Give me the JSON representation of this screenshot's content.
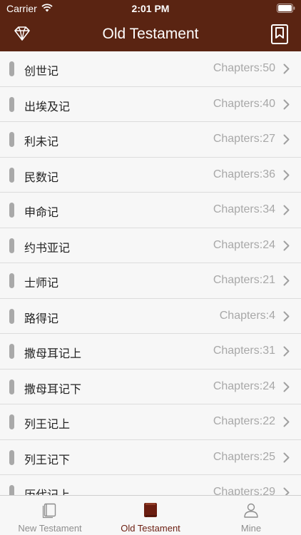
{
  "status_bar": {
    "carrier": "Carrier",
    "time": "2:01 PM"
  },
  "nav": {
    "title": "Old Testament",
    "left_icon": "diamond-icon",
    "right_icon": "bookmark-icon"
  },
  "colors": {
    "header_bg": "#5a2412",
    "active_tab": "#6b1d10",
    "marker": "#a9a9a9"
  },
  "books": [
    {
      "name": "创世记",
      "chapters": "Chapters:50"
    },
    {
      "name": "出埃及记",
      "chapters": "Chapters:40"
    },
    {
      "name": "利未记",
      "chapters": "Chapters:27"
    },
    {
      "name": "民数记",
      "chapters": "Chapters:36"
    },
    {
      "name": "申命记",
      "chapters": "Chapters:34"
    },
    {
      "name": "约书亚记",
      "chapters": "Chapters:24"
    },
    {
      "name": "士师记",
      "chapters": "Chapters:21"
    },
    {
      "name": "路得记",
      "chapters": "Chapters:4"
    },
    {
      "name": "撒母耳记上",
      "chapters": "Chapters:31"
    },
    {
      "name": "撒母耳记下",
      "chapters": "Chapters:24"
    },
    {
      "name": "列王记上",
      "chapters": "Chapters:22"
    },
    {
      "name": "列王记下",
      "chapters": "Chapters:25"
    },
    {
      "name": "历代记上",
      "chapters": "Chapters:29"
    }
  ],
  "tabs": [
    {
      "label": "New Testament",
      "icon": "book-outline-icon",
      "active": false
    },
    {
      "label": "Old Testament",
      "icon": "book-filled-icon",
      "active": true
    },
    {
      "label": "Mine",
      "icon": "person-icon",
      "active": false
    }
  ]
}
